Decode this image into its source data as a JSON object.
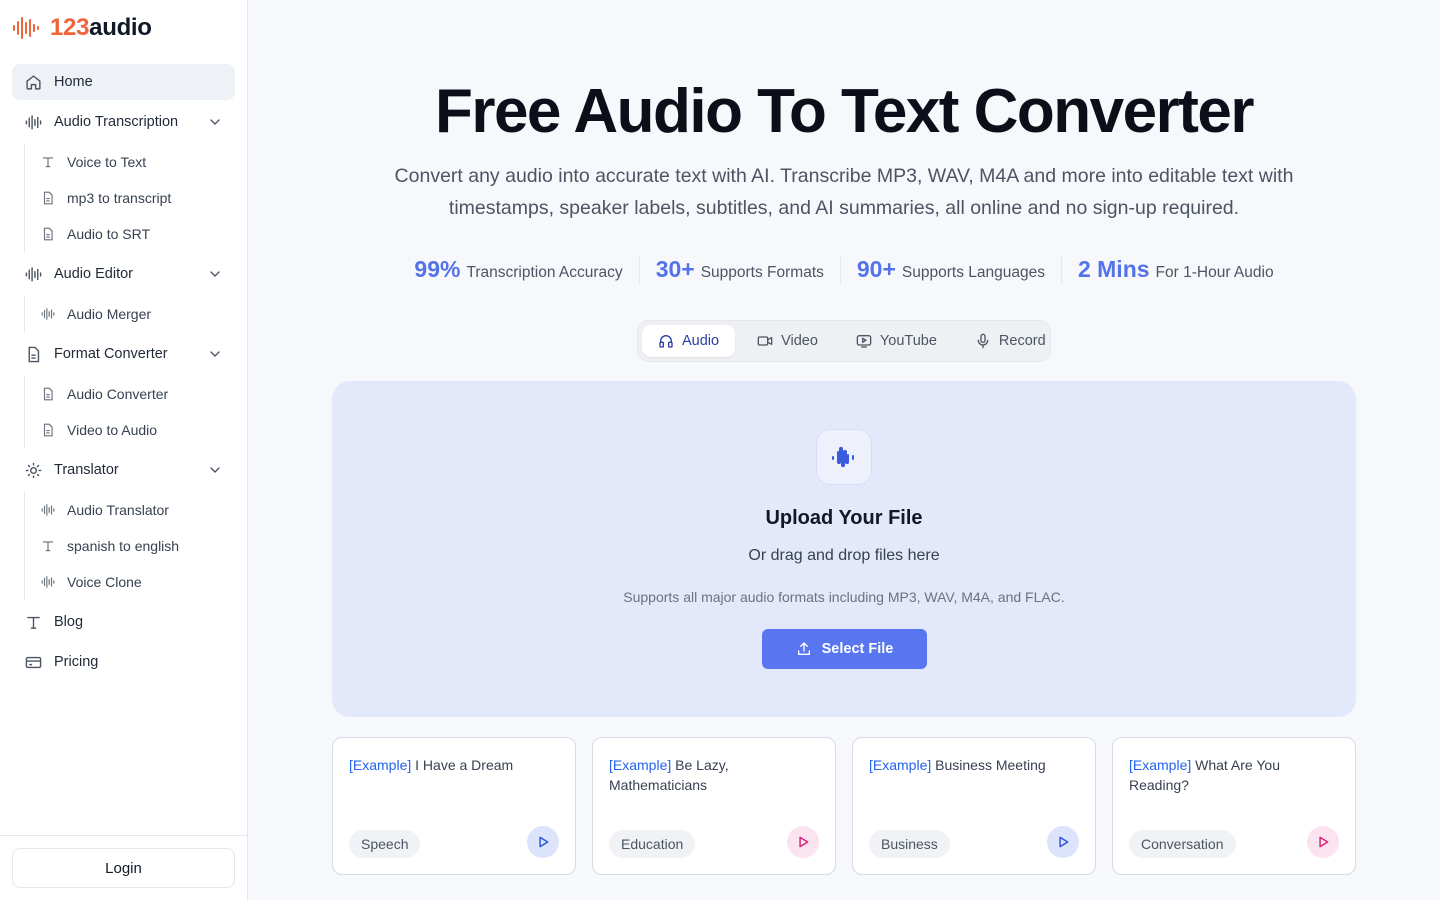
{
  "brand": {
    "num": "123",
    "word": "audio"
  },
  "sidebar": {
    "home": "Home",
    "audio_transcription": {
      "label": "Audio Transcription",
      "items": [
        "Voice to Text",
        "mp3 to transcript",
        "Audio to SRT"
      ]
    },
    "audio_editor": {
      "label": "Audio Editor",
      "items": [
        "Audio Merger"
      ]
    },
    "format_converter": {
      "label": "Format Converter",
      "items": [
        "Audio Converter",
        "Video to Audio"
      ]
    },
    "translator": {
      "label": "Translator",
      "items": [
        "Audio Translator",
        "spanish to english",
        "Voice Clone"
      ]
    },
    "blog": "Blog",
    "pricing": "Pricing",
    "login": "Login"
  },
  "hero": {
    "title": "Free Audio To Text Converter",
    "subtitle": "Convert any audio into accurate text with AI. Transcribe MP3, WAV, M4A and more into editable text with timestamps, speaker labels, subtitles, and AI summaries, all online and no sign-up required."
  },
  "stats": [
    {
      "value": "99%",
      "label": "Transcription Accuracy"
    },
    {
      "value": "30+",
      "label": "Supports Formats"
    },
    {
      "value": "90+",
      "label": "Supports Languages"
    },
    {
      "value": "2 Mins",
      "label": "For 1-Hour Audio"
    }
  ],
  "tabs": [
    "Audio",
    "Video",
    "YouTube",
    "Record"
  ],
  "upload": {
    "title": "Upload Your File",
    "drag": "Or drag and drop files here",
    "support": "Supports all major audio formats including MP3, WAV, M4A, and FLAC.",
    "button": "Select File"
  },
  "examples": [
    {
      "prefix": "[Example]",
      "title": "I Have a Dream",
      "tag": "Speech"
    },
    {
      "prefix": "[Example]",
      "title": "Be Lazy, Mathematicians",
      "tag": "Education"
    },
    {
      "prefix": "[Example]",
      "title": "Business Meeting",
      "tag": "Business"
    },
    {
      "prefix": "[Example]",
      "title": "What Are You Reading?",
      "tag": "Conversation"
    }
  ],
  "colors": {
    "accent": "#5876f0",
    "brand_orange": "#f0643c",
    "stat_blue": "#5573e8",
    "example_blue": "#2563eb",
    "play_pink": "#d3267a"
  }
}
